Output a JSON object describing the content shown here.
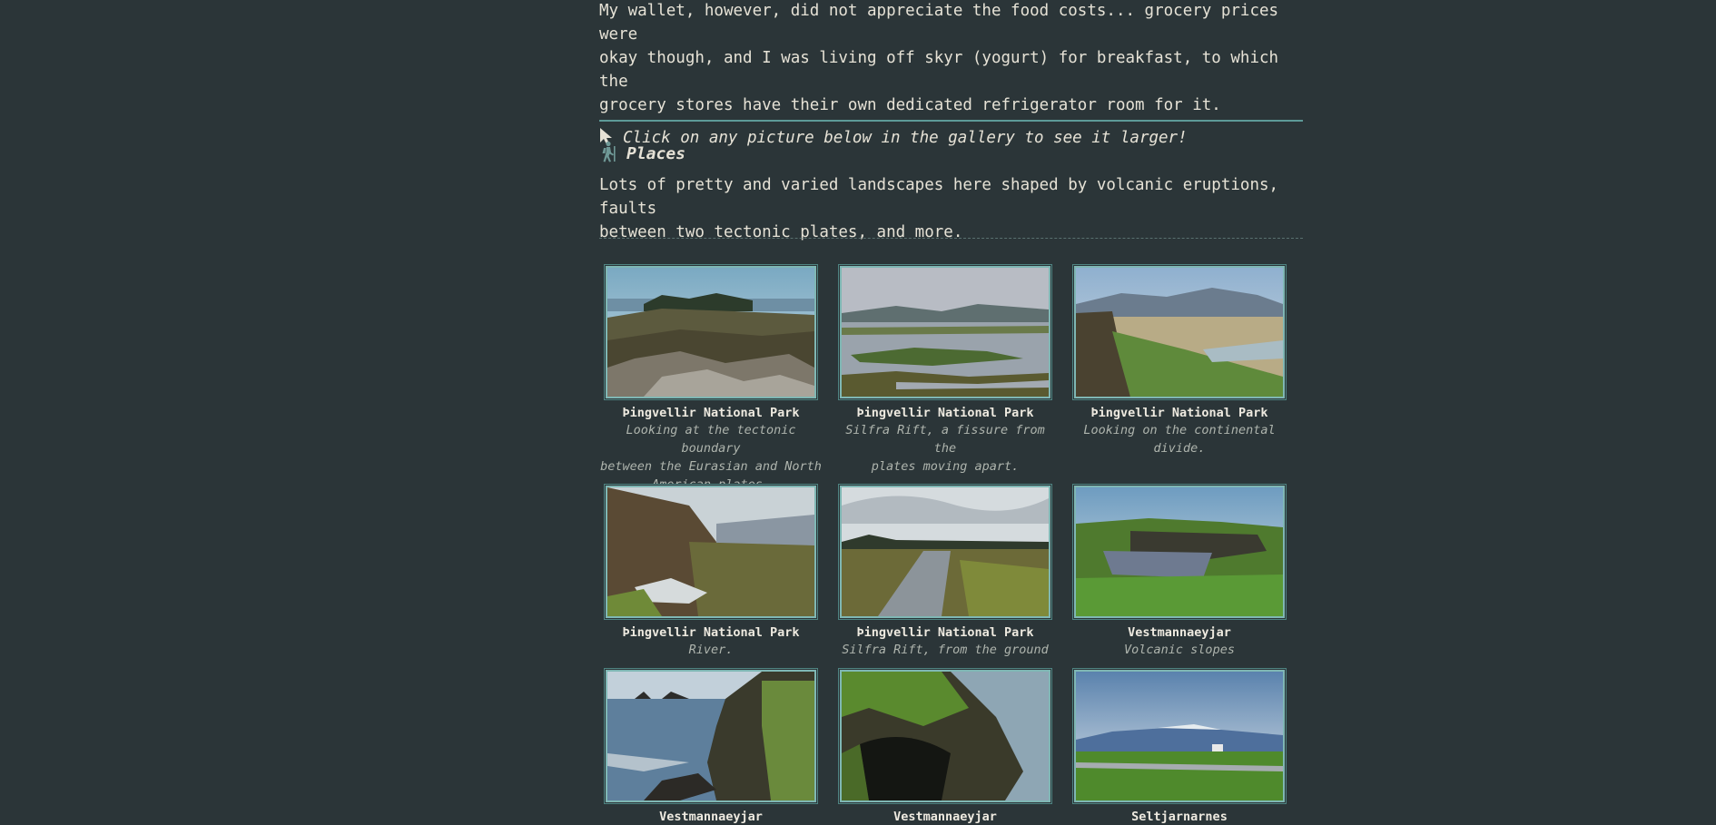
{
  "intro": {
    "paragraph_line1": "My wallet, however, did not appreciate the food costs... grocery prices were",
    "paragraph_line2": "okay though, and I was living off skyr (yogurt) for breakfast, to which the",
    "paragraph_line3": "grocery stores have their own dedicated refrigerator room for it.",
    "hint_icon": "cursor-arrow-icon",
    "hint_text": "Click on any picture below in the gallery to see it larger!"
  },
  "section": {
    "icon": "hiker-icon",
    "title": "Places",
    "desc_line1": "Lots of pretty and varied landscapes here shaped by volcanic eruptions, faults",
    "desc_line2": "between two tectonic plates, and more."
  },
  "gallery": [
    {
      "title": "Þingvellir National Park",
      "desc_lines": [
        "Looking at the tectonic boundary",
        "between the Eurasian and North",
        "American plates."
      ]
    },
    {
      "title": "Þingvellir National Park",
      "desc_lines": [
        "Silfra Rift, a fissure from the",
        "plates moving apart."
      ]
    },
    {
      "title": "Þingvellir National Park",
      "desc_lines": [
        "Looking on the continental",
        "divide."
      ]
    },
    {
      "title": "Þingvellir National Park",
      "desc_lines": [
        "River."
      ]
    },
    {
      "title": "Þingvellir National Park",
      "desc_lines": [
        "Silfra Rift, from the ground"
      ]
    },
    {
      "title": "Vestmannaeyjar",
      "desc_lines": [
        "Volcanic slopes"
      ]
    },
    {
      "title": "Vestmannaeyjar",
      "desc_lines": []
    },
    {
      "title": "Vestmannaeyjar",
      "desc_lines": []
    },
    {
      "title": "Seltjarnarnes",
      "desc_lines": []
    }
  ],
  "colors": {
    "background": "#2b3538",
    "text": "#e6e2d6",
    "accent": "#5d9a98",
    "thumb_border": "#7fb7b4"
  }
}
